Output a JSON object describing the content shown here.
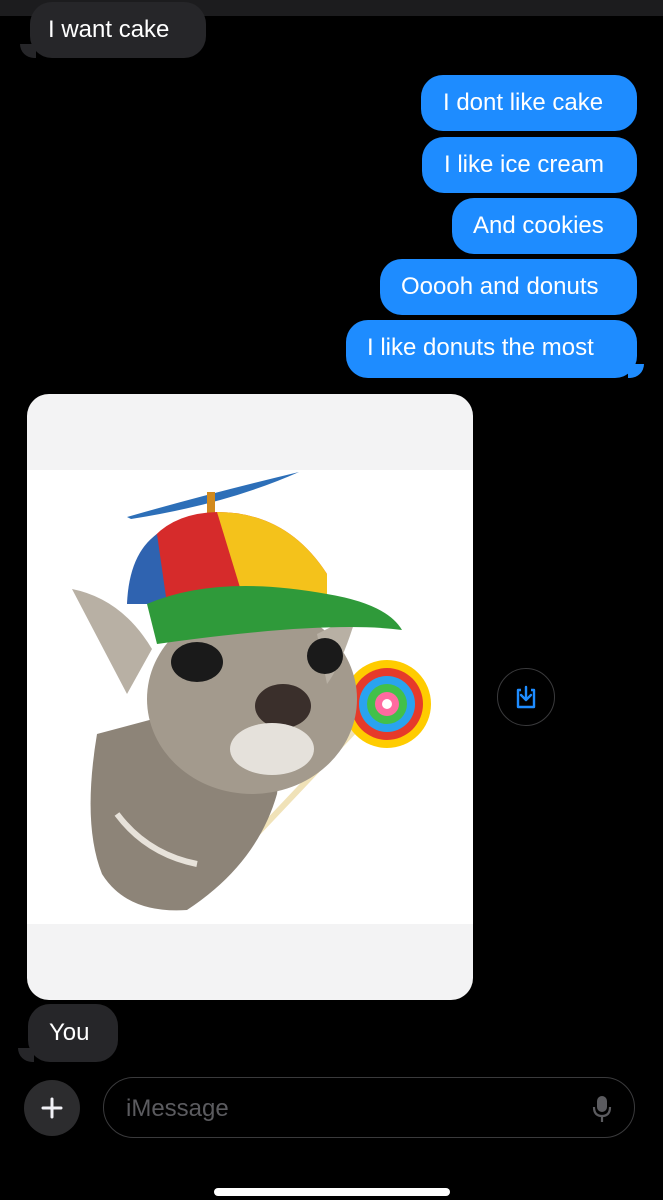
{
  "messages": {
    "incoming_top": "I want cake",
    "outgoing": [
      "I dont like cake",
      "I like ice cream",
      "And cookies",
      "Ooooh and donuts",
      "I like donuts the most"
    ],
    "incoming_bottom": "You"
  },
  "image_message": {
    "description_icon": "cat-with-propeller-cap-and-lollipop-image"
  },
  "composer": {
    "placeholder": "iMessage",
    "add_icon": "plus-icon",
    "mic_icon": "microphone-icon",
    "save_icon": "save-to-photos-icon"
  },
  "colors": {
    "outgoing_bubble": "#1e8cff",
    "incoming_bubble": "#262629",
    "background": "#000000",
    "accent": "#1e8cff"
  }
}
